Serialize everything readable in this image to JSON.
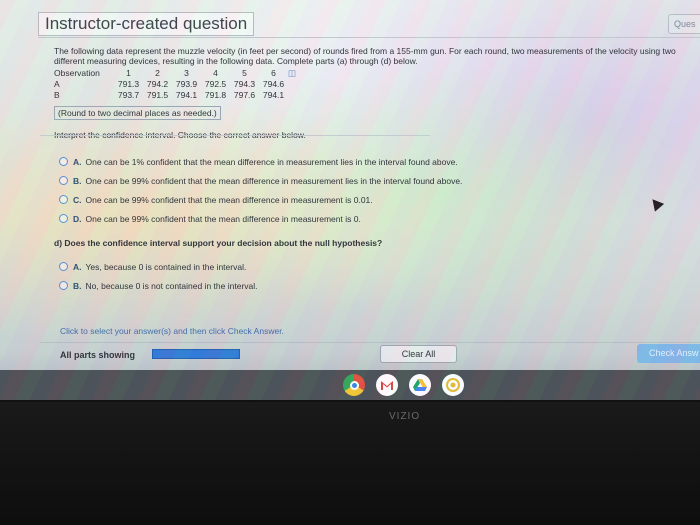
{
  "header": {
    "title": "Instructor-created question",
    "tab_label": "Ques"
  },
  "question": {
    "prompt": "The following data represent the muzzle velocity (in feet per second) of rounds fired from a 155-mm gun. For each round, two measurements of the velocity using two different measuring devices, resulting in the following data. Complete parts (a) through (d) below.",
    "table": {
      "header_label": "Observation",
      "observations": [
        "1",
        "2",
        "3",
        "4",
        "5",
        "6"
      ],
      "rows": [
        {
          "label": "A",
          "values": [
            "791.3",
            "794.2",
            "793.9",
            "792.5",
            "794.3",
            "794.6"
          ]
        },
        {
          "label": "B",
          "values": [
            "793.7",
            "791.5",
            "794.1",
            "791.8",
            "797.6",
            "794.1"
          ]
        }
      ]
    },
    "rounding_note": "(Round to two decimal places as needed.)",
    "instruction": "Interpret the confidence interval. Choose the correct answer below.",
    "options": [
      {
        "letter": "A.",
        "text": "One can be 1% confident that the mean difference in measurement lies in the interval found above."
      },
      {
        "letter": "B.",
        "text": "One can be 99% confident that the mean difference in measurement lies in the interval found above."
      },
      {
        "letter": "C.",
        "text": "One can be 99% confident that the mean difference in measurement is 0.01."
      },
      {
        "letter": "D.",
        "text": "One can be 99% confident that the mean difference in measurement is 0."
      }
    ],
    "part_d": {
      "prompt": "d) Does the confidence interval support your decision about the null hypothesis?",
      "options": [
        {
          "letter": "A.",
          "text": "Yes, because 0 is contained in the interval."
        },
        {
          "letter": "B.",
          "text": "No, because 0 is not contained in the interval."
        }
      ]
    }
  },
  "footer": {
    "click_message": "Click to select your answer(s) and then click Check Answer.",
    "all_parts_label": "All parts showing",
    "progress_fraction": 1.0,
    "clear_all_label": "Clear All",
    "check_answer_label": "Check Answ"
  },
  "taskbar": {
    "apps": [
      "chrome-icon",
      "gmail-icon",
      "drive-icon",
      "photos-icon"
    ]
  },
  "bezel": {
    "brand": "VIZIO"
  },
  "colors": {
    "accent": "#2f79d6",
    "radio_border": "#4d8fd6",
    "link_text": "#3e6aa8"
  }
}
